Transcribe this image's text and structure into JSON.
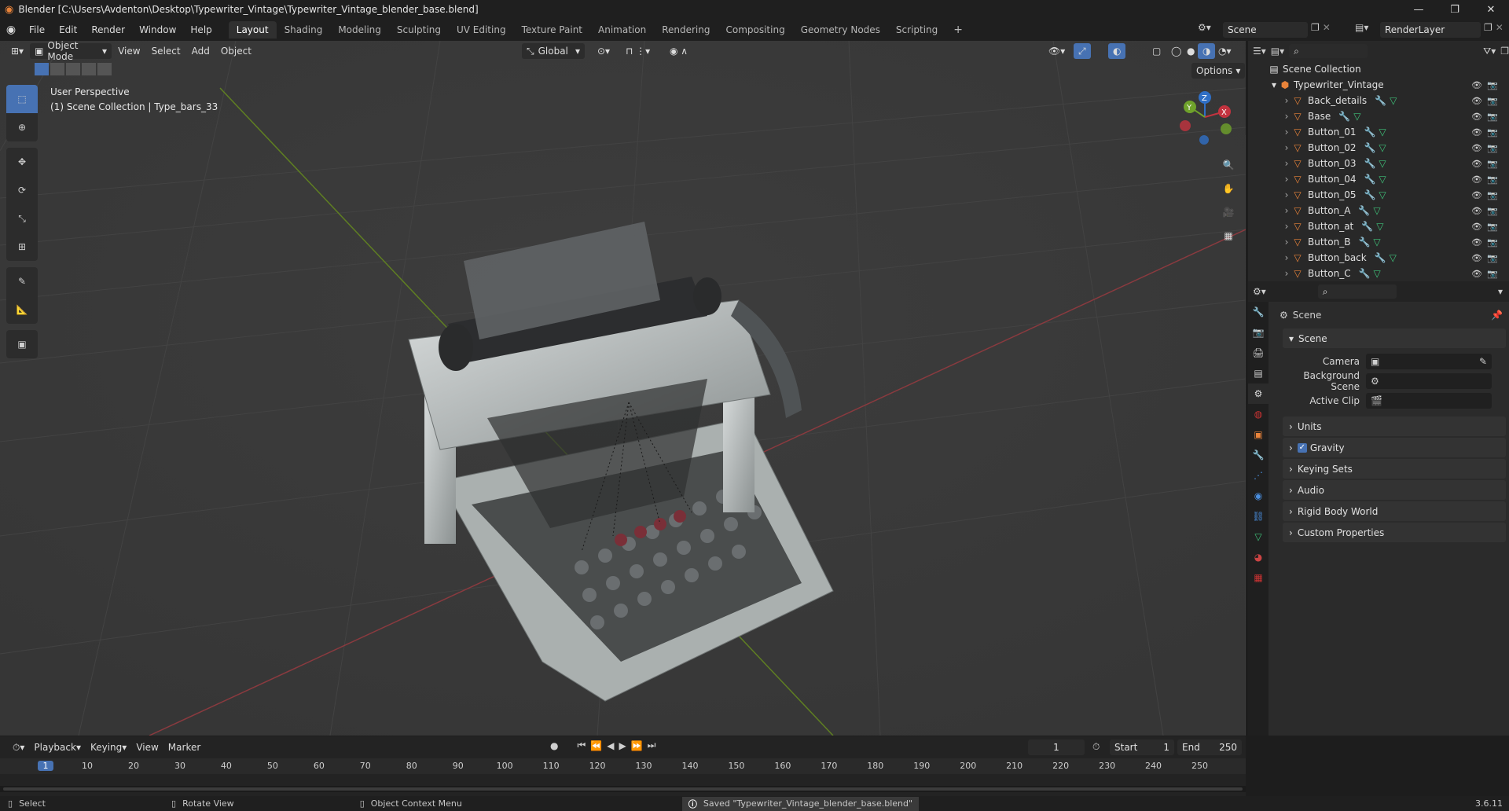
{
  "window": {
    "title": "Blender [C:\\Users\\Avdenton\\Desktop\\Typewriter_Vintage\\Typewriter_Vintage_blender_base.blend]",
    "controls": [
      "—",
      "❐",
      "✕"
    ]
  },
  "menu": [
    "File",
    "Edit",
    "Render",
    "Window",
    "Help"
  ],
  "workspaces": [
    "Layout",
    "Shading",
    "Modeling",
    "Sculpting",
    "UV Editing",
    "Texture Paint",
    "Animation",
    "Rendering",
    "Compositing",
    "Geometry Nodes",
    "Scripting"
  ],
  "active_workspace": "Layout",
  "scene_field": "Scene",
  "render_layer_field": "RenderLayer",
  "viewport": {
    "mode": "Object Mode",
    "menus": [
      "View",
      "Select",
      "Add",
      "Object"
    ],
    "orientation": "Global",
    "options_label": "Options",
    "overlay_line1": "User Perspective",
    "overlay_line2": "(1) Scene Collection | Type_bars_33",
    "gizmo_axes": [
      "X",
      "Y",
      "Z"
    ]
  },
  "outliner": {
    "root": "Scene Collection",
    "collection": "Typewriter_Vintage",
    "objects": [
      "Back_details",
      "Base",
      "Button_01",
      "Button_02",
      "Button_03",
      "Button_04",
      "Button_05",
      "Button_A",
      "Button_at",
      "Button_B",
      "Button_back",
      "Button_C"
    ]
  },
  "properties": {
    "context": "Scene",
    "section": "Scene",
    "fields": [
      {
        "label": "Camera",
        "value": ""
      },
      {
        "label": "Background Scene",
        "value": ""
      },
      {
        "label": "Active Clip",
        "value": ""
      }
    ],
    "panels": [
      "Units",
      "Gravity",
      "Keying Sets",
      "Audio",
      "Rigid Body World",
      "Custom Properties"
    ],
    "gravity_checked": true
  },
  "timeline": {
    "menus": [
      "Playback",
      "Keying",
      "View",
      "Marker"
    ],
    "current_frame": "1",
    "start_label": "Start",
    "start": "1",
    "end_label": "End",
    "end": "250",
    "ruler": [
      "1",
      "10",
      "20",
      "30",
      "40",
      "50",
      "60",
      "70",
      "80",
      "90",
      "100",
      "110",
      "120",
      "130",
      "140",
      "150",
      "160",
      "170",
      "180",
      "190",
      "200",
      "210",
      "220",
      "230",
      "240",
      "250"
    ]
  },
  "status": {
    "select": "Select",
    "rotate": "Rotate View",
    "context_menu": "Object Context Menu",
    "message": "Saved \"Typewriter_Vintage_blender_base.blend\"",
    "version": "3.6.11"
  },
  "colors": {
    "accent": "#4772b3",
    "x_axis": "#9b3a3f",
    "y_axis": "#6b8e23",
    "object_orange": "#e8833a",
    "mesh_green": "#3fc37a"
  }
}
